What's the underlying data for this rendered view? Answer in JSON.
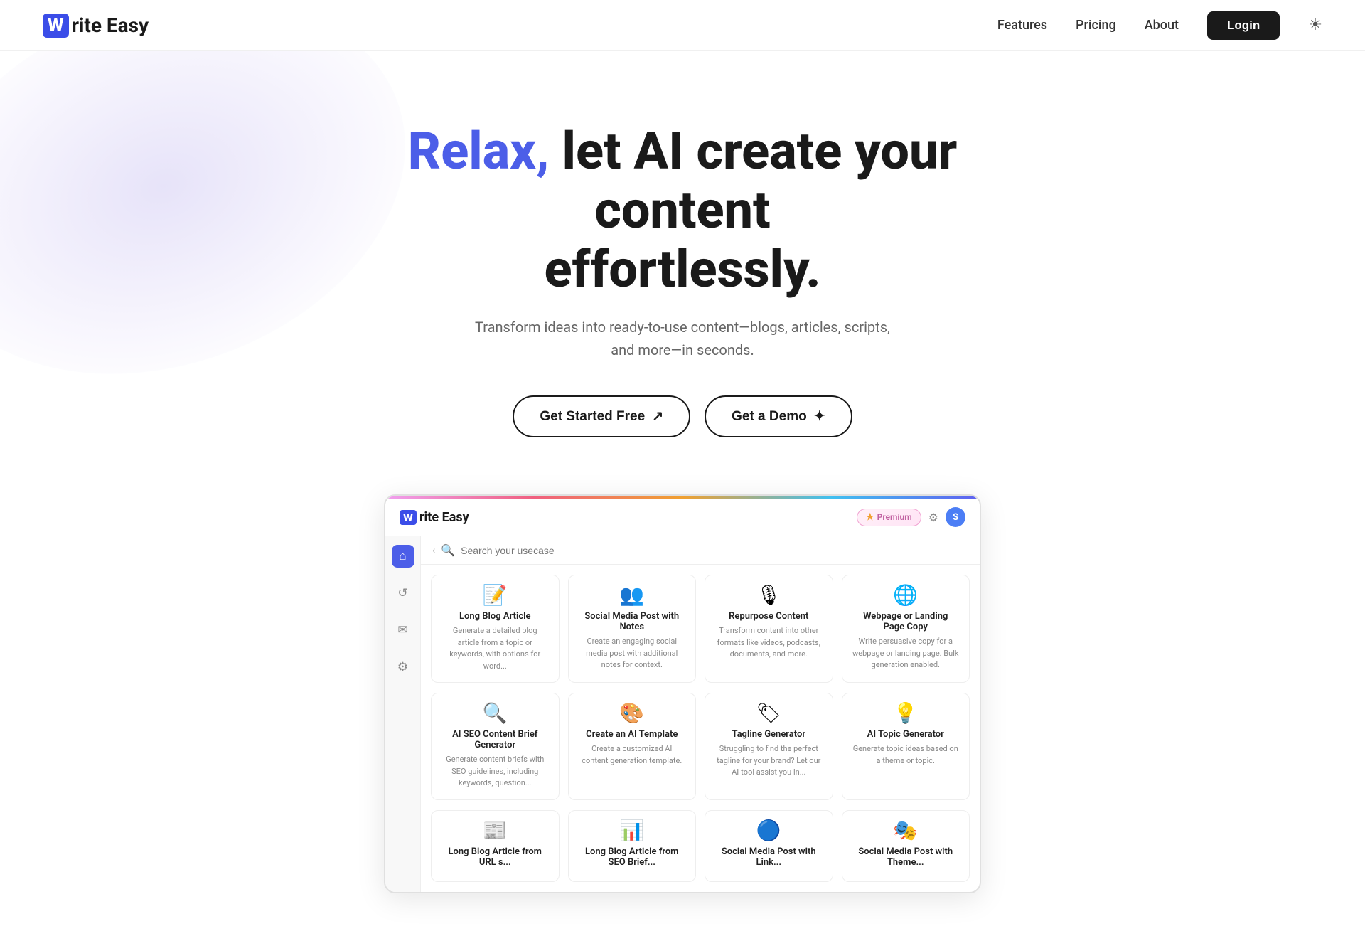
{
  "nav": {
    "logo_w": "W",
    "logo_text": "rite Easy",
    "links": [
      "Features",
      "Pricing",
      "About"
    ],
    "login_label": "Login",
    "theme_icon": "☀"
  },
  "hero": {
    "headline_colored": "Relax,",
    "headline_rest": " let AI create your content effortlessly.",
    "subtext": "Transform ideas into ready-to-use content—blogs, articles, scripts, and more—in seconds.",
    "btn_primary": "Get Started Free",
    "btn_primary_icon": "↗",
    "btn_secondary": "Get a Demo",
    "btn_secondary_icon": "✦"
  },
  "app_preview": {
    "logo_w": "W",
    "logo_text": "rite Easy",
    "premium_label": "Premium",
    "avatar_letter": "S",
    "search_placeholder": "Search your usecase",
    "cards": [
      {
        "icon": "📝",
        "title": "Long Blog Article",
        "desc": "Generate a detailed blog article from a topic or keywords, with options for word..."
      },
      {
        "icon": "👥",
        "title": "Social Media Post with Notes",
        "desc": "Create an engaging social media post with additional notes for context."
      },
      {
        "icon": "🎙",
        "title": "Repurpose Content",
        "desc": "Transform content into other formats like videos, podcasts, documents, and more."
      },
      {
        "icon": "🌐",
        "title": "Webpage or Landing Page Copy",
        "desc": "Write persuasive copy for a webpage or landing page. Bulk generation enabled."
      },
      {
        "icon": "🔍",
        "title": "AI SEO Content Brief Generator",
        "desc": "Generate content briefs with SEO guidelines, including keywords, question..."
      },
      {
        "icon": "🎨",
        "title": "Create an AI Template",
        "desc": "Create a customized AI content generation template."
      },
      {
        "icon": "🏷",
        "title": "Tagline Generator",
        "desc": "Struggling to find the perfect tagline for your brand? Let our AI-tool assist you in..."
      },
      {
        "icon": "💡",
        "title": "AI Topic Generator",
        "desc": "Generate topic ideas based on a theme or topic."
      },
      {
        "icon": "📰",
        "title": "Long Blog Article from URL s...",
        "desc": ""
      },
      {
        "icon": "📊",
        "title": "Long Blog Article from SEO Brief...",
        "desc": ""
      },
      {
        "icon": "🔵",
        "title": "Social Media Post with Link...",
        "desc": ""
      },
      {
        "icon": "🎭",
        "title": "Social Media Post with Theme...",
        "desc": ""
      }
    ]
  }
}
